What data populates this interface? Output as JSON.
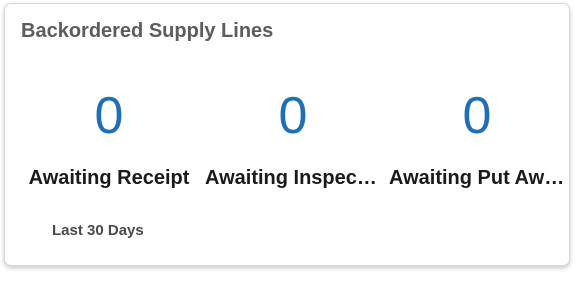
{
  "card": {
    "title": "Backordered Supply Lines",
    "metrics": [
      {
        "value": "0",
        "label": "Awaiting Receipt"
      },
      {
        "value": "0",
        "label": "Awaiting Inspection"
      },
      {
        "value": "0",
        "label": "Awaiting Put Away"
      }
    ],
    "period": "Last 30 Days"
  },
  "colors": {
    "metric_value": "#1f6fb2",
    "title": "#5c5c5c",
    "label": "#1a1a1a"
  }
}
